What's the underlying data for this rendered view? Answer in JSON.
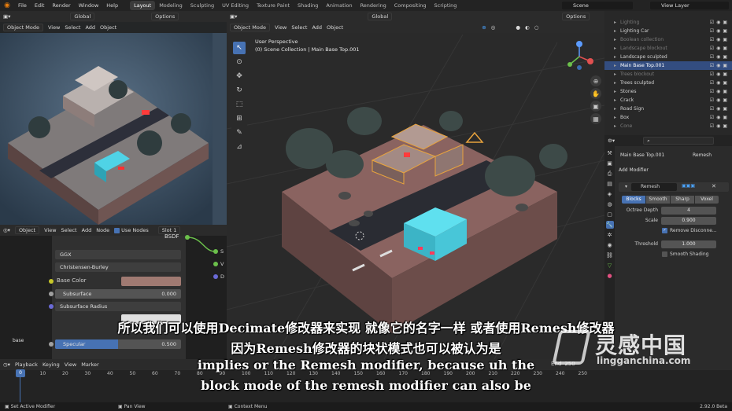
{
  "topbar": {
    "menus": [
      "File",
      "Edit",
      "Render",
      "Window",
      "Help"
    ],
    "workspaces": [
      "Layout",
      "Modeling",
      "Sculpting",
      "UV Editing",
      "Texture Paint",
      "Shading",
      "Animation",
      "Rendering",
      "Compositing",
      "Scripting"
    ],
    "active_workspace": "Layout",
    "scene": "Scene",
    "view_layer": "View Layer"
  },
  "render_header": {
    "transform": "Global",
    "options": "Options",
    "mode": "Object Mode",
    "view": "View",
    "select": "Select",
    "add": "Add",
    "object": "Object"
  },
  "viewport": {
    "transform": "Global",
    "options": "Options",
    "mode": "Object Mode",
    "view": "View",
    "select": "Select",
    "add": "Add",
    "object": "Object",
    "perspective": "User Perspective",
    "collection_info": "(0) Scene Collection | Main Base Top.001",
    "gizmo_z": "Z",
    "gizmo_y": "Y"
  },
  "outliner": {
    "rows": [
      {
        "label": "Lighting",
        "state": "dim"
      },
      {
        "label": "Lighting Car",
        "state": "normal"
      },
      {
        "label": "Boolean collection",
        "state": "dim"
      },
      {
        "label": "Landscape blockout",
        "state": "dim"
      },
      {
        "label": "Landscape sculpted",
        "state": "normal"
      },
      {
        "label": "Main Base Top.001",
        "state": "sel"
      },
      {
        "label": "Trees blockout",
        "state": "dim"
      },
      {
        "label": "Trees sculpted",
        "state": "normal"
      },
      {
        "label": "Stones",
        "state": "normal"
      },
      {
        "label": "Crack",
        "state": "normal"
      },
      {
        "label": "Road Sign",
        "state": "normal"
      },
      {
        "label": "Box",
        "state": "normal"
      },
      {
        "label": "Cone",
        "state": "dim"
      }
    ]
  },
  "properties": {
    "object_name": "Main Base Top.001",
    "modifier_type": "Remesh",
    "add_modifier": "Add Modifier",
    "modifier_name": "Remesh",
    "modes": [
      "Blocks",
      "Smooth",
      "Sharp",
      "Voxel"
    ],
    "active_mode": "Blocks",
    "octree_depth_label": "Octree Depth",
    "octree_depth": "4",
    "scale_label": "Scale",
    "scale": "0.900",
    "remove_disconnected": "Remove Disconne...",
    "threshold_label": "Threshold",
    "threshold": "1.000",
    "smooth_shading": "Smooth Shading"
  },
  "node_editor": {
    "mode": "Object",
    "view": "View",
    "select": "Select",
    "add": "Add",
    "node": "Node",
    "use_nodes": "Use Nodes",
    "slot": "Slot 1",
    "bsdf": "BSDF",
    "distribution": "GGX",
    "subsurface_method": "Christensen-Burley",
    "base_color": "Base Color",
    "subsurface": "Subsurface",
    "subsurface_value": "0.000",
    "subsurface_radius": "Subsurface Radius",
    "specular": "Specular",
    "specular_value": "0.500",
    "side_label": "base",
    "socket_labels": [
      "S",
      "V",
      "D"
    ],
    "base_color_hex": "#a07a72"
  },
  "timeline": {
    "playback": "Playback",
    "keying": "Keying",
    "view": "View",
    "marker": "Marker",
    "frames": [
      "0",
      "10",
      "20",
      "30",
      "40",
      "50",
      "60",
      "70",
      "80",
      "90",
      "100",
      "110",
      "120",
      "130",
      "140",
      "150",
      "160",
      "170",
      "180",
      "190",
      "200",
      "210",
      "220",
      "230",
      "240",
      "250"
    ],
    "current_frame": "0",
    "end_label": "End",
    "end_value": "250"
  },
  "statusbar": {
    "left": "Set Active Modifier",
    "middle": "Pan View",
    "right": "Context Menu",
    "version": "2.92.0 Beta"
  },
  "subtitles": {
    "zh_line1": "所以我们可以使用Decimate修改器来实现 就像它的名字一样 或者使用Remesh修改器",
    "zh_line2": "因为Remesh修改器的块状模式也可以被认为是",
    "en_line1": "implies or the Remesh modifier, because uh the",
    "en_line2": "block mode of the remesh modifier can also be"
  },
  "watermark": {
    "brand": "灵感中国",
    "url": "lingganchina.com"
  },
  "colors": {
    "accent": "#4772b3",
    "blender_orange": "#e87d0d",
    "car": "#3ec6d8",
    "ground": "#6b4a47",
    "selection_outline": "#e8a33d"
  }
}
